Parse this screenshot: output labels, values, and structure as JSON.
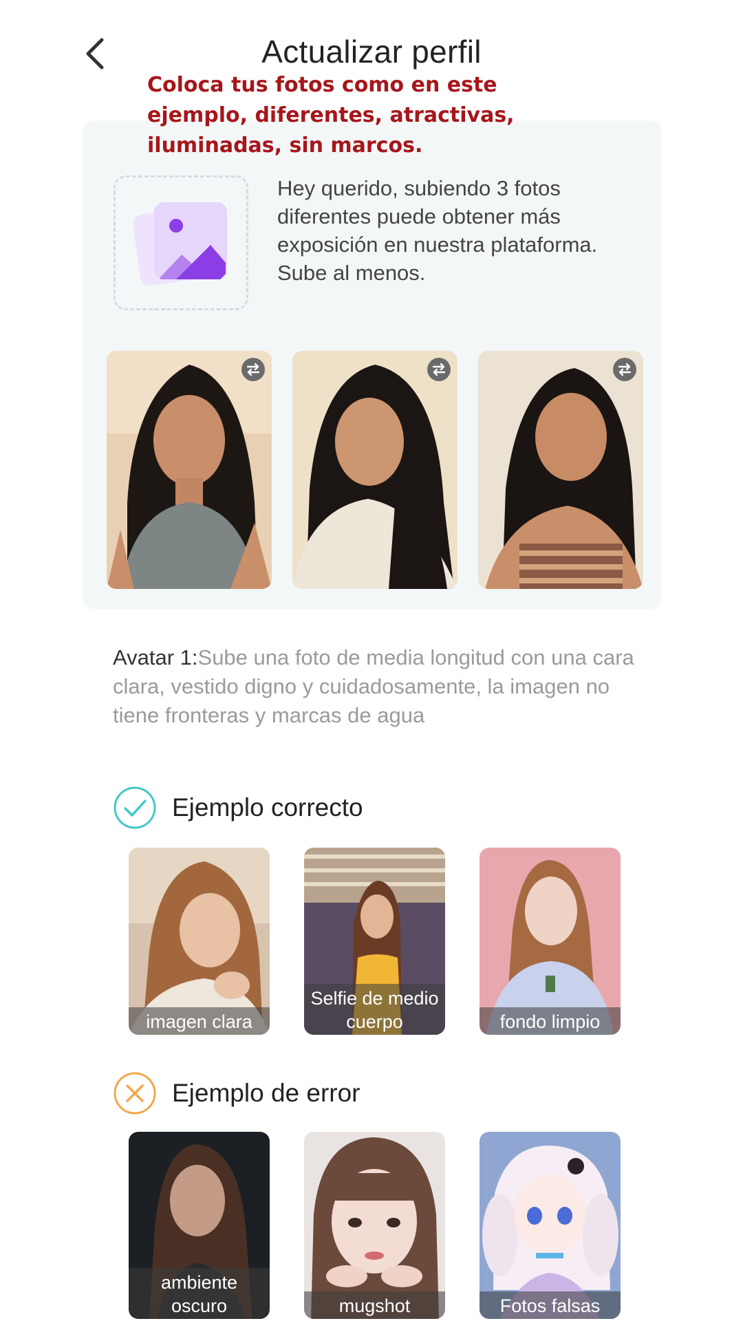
{
  "header": {
    "title": "Actualizar perfil"
  },
  "overlay_note": "Coloca tus fotos como en este ejemplo, diferentes, atractivas, iluminadas, sin marcos.",
  "tip_card": {
    "message": "Hey querido, subiendo 3 fotos diferentes puede obtener más exposición en nuestra plataforma. Sube al menos.",
    "accent_color": "#8b3ee6"
  },
  "avatar_requirement": {
    "label": "Avatar 1:",
    "text": "Sube una foto de media longitud con una cara clara, vestido digno y cuidadosamente, la imagen no tiene fronteras y marcas de agua"
  },
  "correct_examples": {
    "title": "Ejemplo correcto",
    "icon_color": "#3fc8c4",
    "items": [
      {
        "caption": "imagen clara"
      },
      {
        "caption": "Selfie de medio cuerpo"
      },
      {
        "caption": "fondo limpio"
      }
    ]
  },
  "error_examples": {
    "title": "Ejemplo de error",
    "icon_color": "#f4a64a",
    "items": [
      {
        "caption": "ambiente oscuro"
      },
      {
        "caption": "mugshot"
      },
      {
        "caption": "Fotos falsas"
      }
    ]
  }
}
